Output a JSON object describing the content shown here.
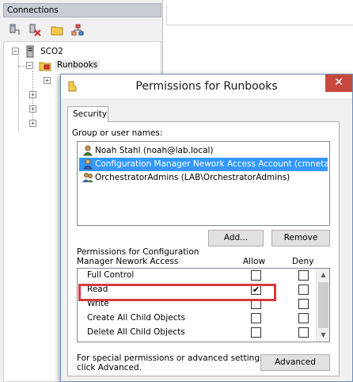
{
  "connections": {
    "header": "Connections",
    "toolbar_icons": [
      "connect-icon",
      "disconnect-icon",
      "new-folder-icon",
      "hierarchy-icon"
    ],
    "tree": {
      "server": "SCO2",
      "runbooks": "Runbooks"
    }
  },
  "dialog": {
    "title": "Permissions for Runbooks",
    "close_glyph": "✕",
    "tab": "Security",
    "group_label": "Group or user names:",
    "users": [
      {
        "name": "Noah Stahl (noah@lab.local)",
        "selected": false
      },
      {
        "name": "Configuration Manager Nework Access Account (cmnetacc...",
        "selected": true
      },
      {
        "name": "OrchestratorAdmins (LAB\\OrchestratorAdmins)",
        "selected": false
      }
    ],
    "add_button": "Add...",
    "remove_button": "Remove",
    "permissions_label_line1": "Permissions for Configuration",
    "permissions_label_line2": "Manager Nework Access",
    "allow_header": "Allow",
    "deny_header": "Deny",
    "permissions": [
      {
        "name": "Full Control",
        "allow": false,
        "deny": false
      },
      {
        "name": "Read",
        "allow": true,
        "deny": false
      },
      {
        "name": "Write",
        "allow": false,
        "deny": false
      },
      {
        "name": "Create All Child Objects",
        "allow": false,
        "deny": false
      },
      {
        "name": "Delete All Child Objects",
        "allow": false,
        "deny": false
      }
    ],
    "special_line1": "For special permissions or advanced settings,",
    "special_line2": "click Advanced.",
    "advanced_button": "Advanced",
    "check_glyph": "✔",
    "highlight_color": "#d93b3b",
    "selection_color": "#3399ff"
  }
}
